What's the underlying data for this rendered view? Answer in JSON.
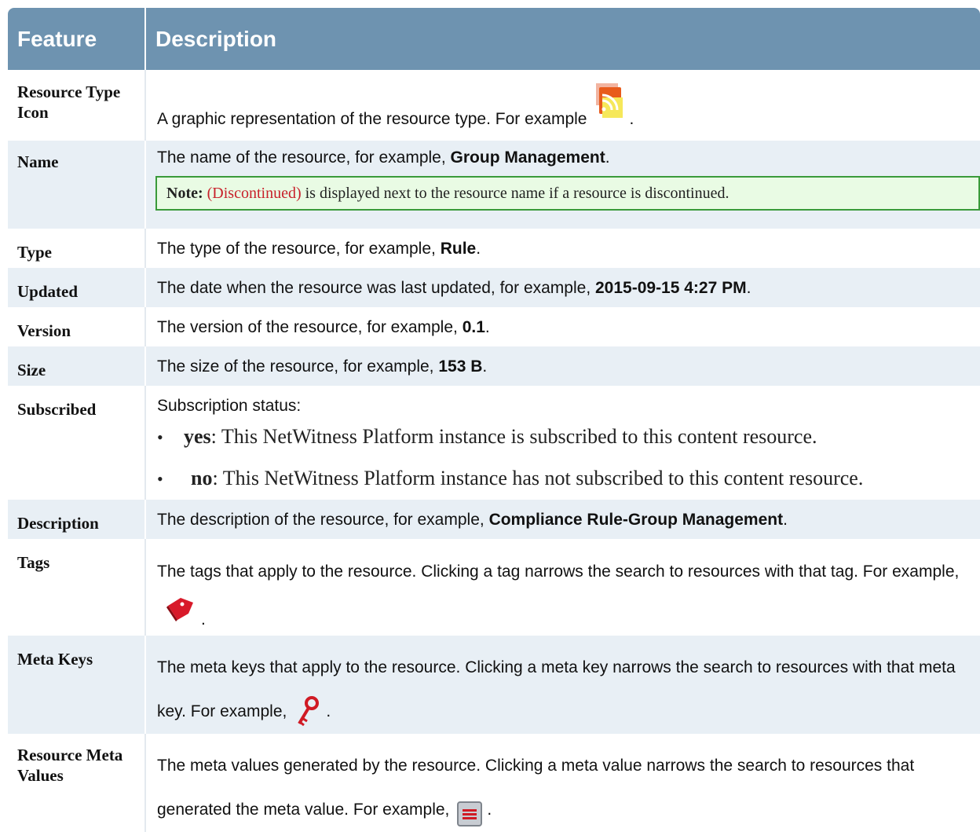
{
  "header": {
    "feature": "Feature",
    "description": "Description"
  },
  "rows": {
    "icon": {
      "feature": "Resource Type Icon",
      "text": "A graphic representation of the resource type. For example",
      "end": ".",
      "icon_name": "rss-feed-icon"
    },
    "name": {
      "feature": "Name",
      "text": "The name of the resource, for example,",
      "value": "Group Management",
      "end": ".",
      "note_label": "Note:",
      "note_highlight": "(Discontinued)",
      "note_text": "is displayed next to the resource name if a resource is discontinued."
    },
    "type": {
      "feature": "Type",
      "text": "The type of the resource, for example,",
      "value": "Rule",
      "end": "."
    },
    "updated": {
      "feature": "Updated",
      "text": "The date when the resource was last updated, for example,",
      "value": "2015-09-15 4:27 PM",
      "end": "."
    },
    "version": {
      "feature": "Version",
      "text": "The version of the resource, for example,",
      "value": "0.1",
      "end": "."
    },
    "size": {
      "feature": "Size",
      "text": "The size of the resource, for example,",
      "value": "153 B",
      "end": "."
    },
    "subscribed": {
      "feature": "Subscribed",
      "text": "Subscription status:",
      "items": [
        {
          "term": "yes",
          "text": ": This NetWitness Platform instance is subscribed to this content resource."
        },
        {
          "term": "no",
          "text": ": This NetWitness Platform instance has not subscribed to this content resource."
        }
      ]
    },
    "description": {
      "feature": "Description",
      "text": "The description of the resource, for example,",
      "value": "Compliance Rule-Group Management",
      "end": "."
    },
    "tags": {
      "feature": "Tags",
      "text": "The tags that apply to the resource. Clicking a tag narrows the search to resources with that tag. For example,",
      "end": ".",
      "icon_name": "tag-icon"
    },
    "metakeys": {
      "feature": "Meta Keys",
      "text": "The meta keys that apply to the resource. Clicking a meta key narrows the search to resources with that meta key. For example,",
      "end": ".",
      "icon_name": "key-icon"
    },
    "metavalues": {
      "feature": "Resource Meta Values",
      "text": "The meta values generated by the resource. Clicking a meta value narrows the search to resources that generated the meta value. For example,",
      "end": ".",
      "icon_name": "meta-value-icon"
    }
  },
  "colors": {
    "header_bg": "#6e93b0",
    "alt_row_bg": "#e8eff5",
    "note_border": "#3a9a3a",
    "note_bg": "#e9fbe4",
    "discontinued_red": "#c8202a"
  }
}
